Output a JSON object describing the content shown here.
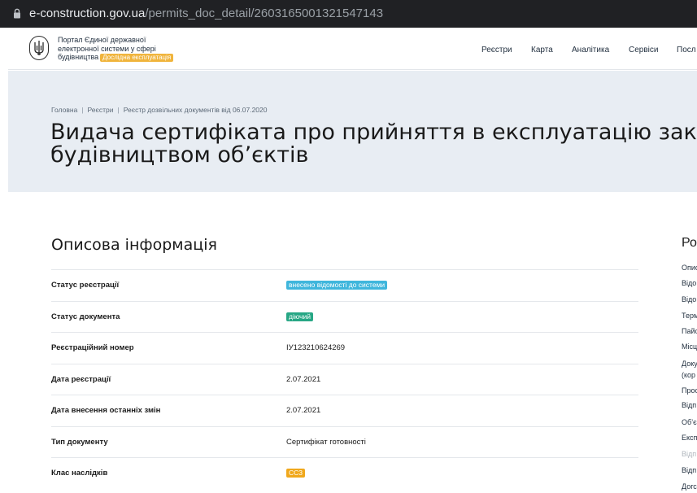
{
  "browser": {
    "url_host": "e-construction.gov.ua",
    "url_path": "/permits_doc_detail/2603165001321547143"
  },
  "header": {
    "portal_line1": "Портал Єдиної державної",
    "portal_line2": "електронної системи у сфері",
    "portal_line3": "будівництва",
    "beta_badge": "Дослідна експлуатація",
    "nav": [
      "Реєстри",
      "Карта",
      "Аналітика",
      "Сервіси",
      "Посл"
    ]
  },
  "breadcrumb": [
    "Головна",
    "Реєстри",
    "Реєстр дозвільних документів від 06.07.2020"
  ],
  "page": {
    "title_line1": "Видача сертифіката про прийняття в експлуатацію закі",
    "title_line2": "будівництвом об’єктів"
  },
  "section": {
    "title": "Описова інформація",
    "rows": [
      {
        "label": "Статус реєстрації",
        "value": "внесено відомості до системи",
        "badge": true,
        "color": "#3fb6dc"
      },
      {
        "label": "Статус документа",
        "value": "діючий",
        "badge": true,
        "color": "#27a785"
      },
      {
        "label": "Реєстраційний номер",
        "value": "ІУ123210624269",
        "badge": false
      },
      {
        "label": "Дата реєстрації",
        "value": "2.07.2021",
        "badge": false
      },
      {
        "label": "Дата внесення останніх змін",
        "value": "2.07.2021",
        "badge": false
      },
      {
        "label": "Тип документу",
        "value": "Сертифікат готовності",
        "badge": false
      },
      {
        "label": "Клас наслідків",
        "value": "СС3",
        "badge": true,
        "color": "#f0a81c"
      }
    ]
  },
  "sidebar": {
    "title": "Ро",
    "items": [
      "Опис",
      "Відо",
      "Відо",
      "Терм",
      "Пайс",
      "Місц",
      "Доку",
      "(кор",
      "Прос",
      "Відп",
      "Об’є",
      "Експ",
      "Відп",
      "Відп",
      "Догс"
    ],
    "muted_index": 12
  }
}
